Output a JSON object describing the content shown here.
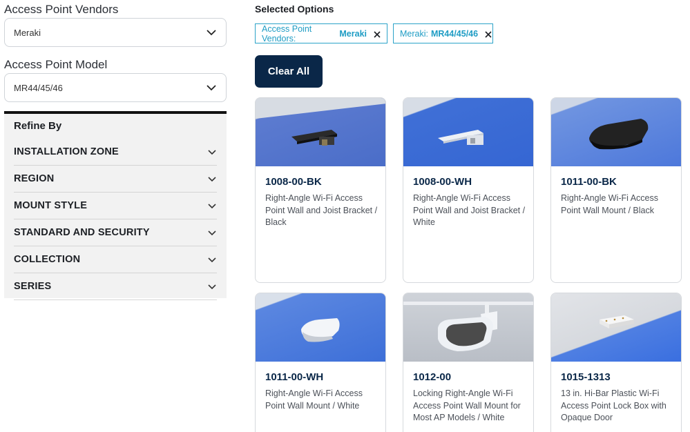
{
  "filters": {
    "vendor": {
      "label": "Access Point Vendors",
      "value": "Meraki"
    },
    "model": {
      "label": "Access Point Model",
      "value": "MR44/45/46"
    }
  },
  "refine": {
    "title": "Refine By",
    "items": [
      {
        "label": "INSTALLATION ZONE"
      },
      {
        "label": "REGION"
      },
      {
        "label": "MOUNT STYLE"
      },
      {
        "label": "STANDARD AND SECURITY"
      },
      {
        "label": "COLLECTION"
      },
      {
        "label": "SERIES"
      }
    ]
  },
  "selected": {
    "title": "Selected Options",
    "chips": [
      {
        "key": "Access Point Vendors:",
        "value": "Meraki"
      },
      {
        "key": "Meraki:",
        "value": "MR44/45/46"
      }
    ],
    "clear_label": "Clear All"
  },
  "products": [
    {
      "sku": "1008-00-BK",
      "desc": "Right-Angle Wi-Fi Access Point Wall and Joist Bracket / Black"
    },
    {
      "sku": "1008-00-WH",
      "desc": "Right-Angle Wi-Fi Access Point Wall and Joist Bracket / White"
    },
    {
      "sku": "1011-00-BK",
      "desc": "Right-Angle Wi-Fi Access Point Wall Mount / Black"
    },
    {
      "sku": "1011-00-WH",
      "desc": "Right-Angle Wi-Fi Access Point Wall Mount / White"
    },
    {
      "sku": "1012-00",
      "desc": "Locking Right-Angle Wi-Fi Access Point Wall Mount for Most AP Models / White"
    },
    {
      "sku": "1015-1313",
      "desc": "13 in. Hi-Bar Plastic Wi-Fi Access Point Lock Box with Opaque Door"
    }
  ],
  "icons": {
    "dropdown": "chevron-down-icon",
    "remove": "close-icon"
  },
  "colors": {
    "accent": "#1e9cc4",
    "primary": "#0a2748",
    "panel": "#f2f2f2"
  }
}
